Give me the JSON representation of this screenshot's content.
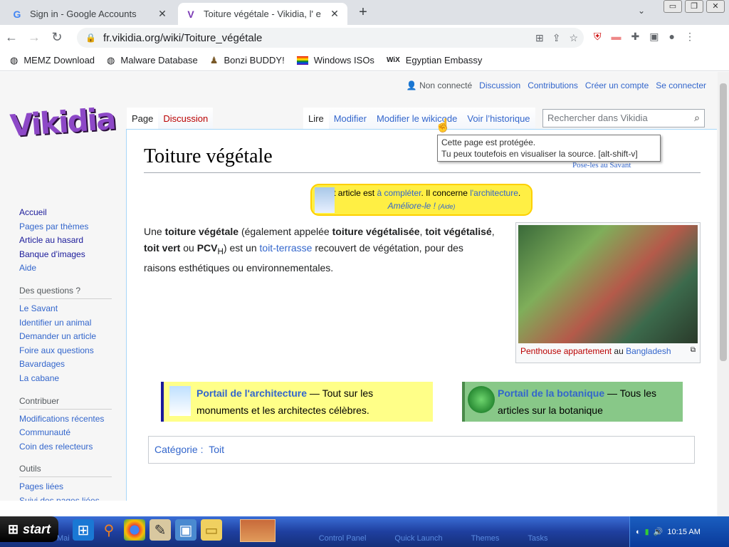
{
  "browser": {
    "tabs": [
      {
        "title": "Sign in - Google Accounts",
        "favicon": "G",
        "active": false
      },
      {
        "title": "Toiture végétale - Vikidia, l' e",
        "favicon": "V",
        "active": true
      }
    ],
    "url": "fr.vikidia.org/wiki/Toiture_végétale",
    "bookmarks": [
      {
        "label": "MEMZ Download",
        "icon": "globe-icon"
      },
      {
        "label": "Malware Database",
        "icon": "globe-icon"
      },
      {
        "label": "Bonzi BUDDY!",
        "icon": "bonzi-icon"
      },
      {
        "label": "Windows ISOs",
        "icon": "rainbow-flag-icon"
      },
      {
        "label": "Egyptian Embassy",
        "icon": "wix-icon"
      }
    ]
  },
  "wiki": {
    "logo": "Vikidia",
    "personal": {
      "not_logged": "Non connecté",
      "discussion": "Discussion",
      "contributions": "Contributions",
      "create": "Créer un compte",
      "login": "Se connecter"
    },
    "tabs_left": [
      "Page",
      "Discussion"
    ],
    "tabs_right": [
      "Lire",
      "Modifier",
      "Modifier le wikicode",
      "Voir l’historique"
    ],
    "search_placeholder": "Rechercher dans Vikidia",
    "sidebar": {
      "main": [
        "Accueil",
        "Pages par thèmes",
        "Article au hasard",
        "Banque d’images",
        "Aide"
      ],
      "questions_heading": "Des questions ?",
      "questions": [
        "Le Savant",
        "Identifier un animal",
        "Demander un article",
        "Foire aux questions",
        "Bavardages",
        "La cabane"
      ],
      "contrib_heading": "Contribuer",
      "contrib": [
        "Modifications récentes",
        "Communauté",
        "Coin des relecteurs"
      ],
      "tools_heading": "Outils",
      "tools": [
        "Pages liées",
        "Suivi des pages liées"
      ]
    },
    "title": "Toiture végétale",
    "savant": "Pose-les au Savant",
    "ebauche": {
      "line1_pre": "Cet article est ",
      "line1_link1": "à compléter",
      "line1_mid": ". Il concerne ",
      "line1_link2": "l'architecture",
      "line1_end": ".",
      "line2": "Améliore-le !",
      "aide": "(Aide)"
    },
    "lead": {
      "t1": "Une ",
      "b1": "toiture végétale",
      "t2": " (également appelée ",
      "b2": "toiture végétalisée",
      "t3": ", ",
      "b3": "toit végétalisé",
      "t4": ", ",
      "b4": "toit vert",
      "t5": " ou ",
      "b5": "PCV",
      "sub": "H",
      "t6": ") est un ",
      "link": "toit-terrasse",
      "t7": " recouvert de végétation, pour des raisons esthétiques ou environnementales."
    },
    "thumb_caption": {
      "red": "Penthouse appartement",
      "mid": " au ",
      "blue": "Bangladesh"
    },
    "portal1": {
      "title": "Portail de l'architecture",
      "text": " —  Tout sur les monuments et les architectes célèbres."
    },
    "portal2": {
      "title": "Portail de la botanique",
      "text": " —  Tous les articles sur la botanique"
    },
    "category_label": "Catégorie :",
    "category": "Toit",
    "tooltip": [
      "Cette page est protégée.",
      "Tu peux toutefois en visualiser la source. [alt-shift-v]"
    ]
  },
  "taskbar": {
    "start": "start",
    "labels": [
      "Mai",
      "Control Panel",
      "Quick Launch",
      "Themes",
      "Tasks"
    ],
    "time": "10:15 AM"
  }
}
